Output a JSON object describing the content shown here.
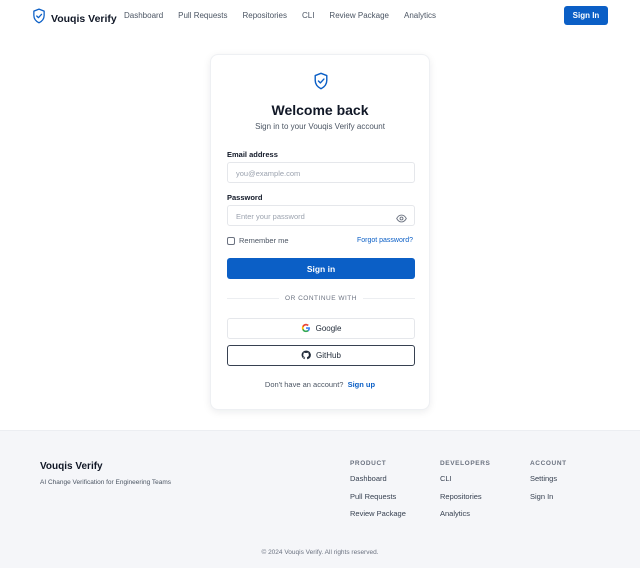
{
  "header": {
    "brand": "Vouqis Verify",
    "nav": [
      "Dashboard",
      "Pull Requests",
      "Repositories",
      "CLI",
      "Review Package",
      "Analytics"
    ],
    "signin_label": "Sign In"
  },
  "card": {
    "title": "Welcome back",
    "subtitle": "Sign in to your Vouqis Verify account",
    "email_label": "Email address",
    "email_placeholder": "you@example.com",
    "password_label": "Password",
    "password_placeholder": "Enter your password",
    "remember_label": "Remember me",
    "forgot_label": "Forgot password?",
    "signin_label": "Sign in",
    "divider_label": "OR CONTINUE WITH",
    "google_label": "Google",
    "github_label": "GitHub",
    "signup_prompt": "Don't have an account?",
    "signup_link": "Sign up"
  },
  "footer": {
    "brand": "Vouqis Verify",
    "tagline": "AI Change Verification for Engineering Teams",
    "columns": [
      {
        "heading": "PRODUCT",
        "items": [
          "Dashboard",
          "Pull Requests",
          "Review Package"
        ]
      },
      {
        "heading": "DEVELOPERS",
        "items": [
          "CLI",
          "Repositories",
          "Analytics"
        ]
      },
      {
        "heading": "ACCOUNT",
        "items": [
          "Settings",
          "Sign In"
        ]
      }
    ],
    "copyright": "© 2024 Vouqis Verify. All rights reserved."
  },
  "colors": {
    "accent": "#0b5fc6",
    "footer_bg": "#f5f6f9"
  }
}
